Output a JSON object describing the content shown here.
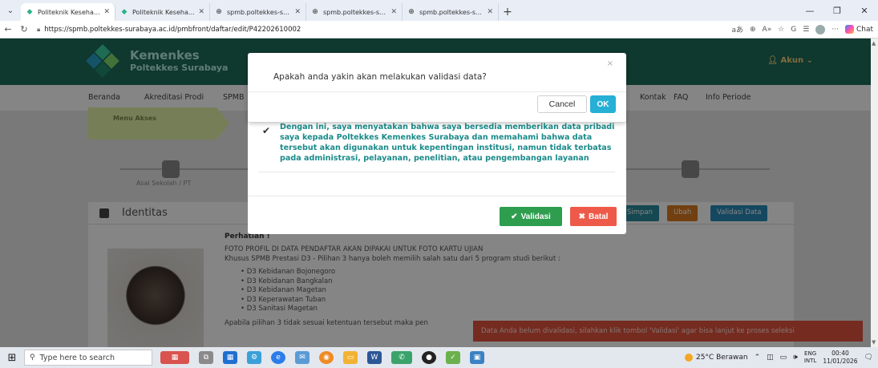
{
  "browser": {
    "tabs": [
      {
        "title": "Politeknik Kesehatan Kemenkes Su",
        "active": true
      },
      {
        "title": "Politeknik Kesehatan Kemenkes Su",
        "active": false
      },
      {
        "title": "spmb.poltekkes-surabaya.ac.id/pm",
        "active": false
      },
      {
        "title": "spmb.poltekkes-surabaya.ac.id/pm",
        "active": false
      },
      {
        "title": "spmb.poltekkes-surabaya.ac.id/pm",
        "active": false
      }
    ],
    "url": "https://spmb.poltekkes-surabaya.ac.id/pmbfront/daftar/edit/P42202610002",
    "copilot_label": "Chat"
  },
  "site": {
    "brand_line1": "Kemenkes",
    "brand_line2": "Poltekkes Surabaya",
    "account_label": "Akun",
    "nav_items": [
      "Beranda",
      "Akreditasi Prodi",
      "SPMB",
      "Kontak",
      "FAQ",
      "Info Periode"
    ],
    "menu_label": "Menu Akses",
    "step_label": "Asal Sekolah / PT",
    "section_title": "Identitas",
    "section_buttons": [
      "Simpan",
      "Ubah",
      "Validasi Data"
    ],
    "perhatian_title": "Perhatian !",
    "perhatian_line1": "FOTO PROFIL DI DATA PENDAFTAR AKAN DIPAKAI UNTUK FOTO KARTU UJIAN",
    "perhatian_line2": "Khusus SPMB Prestasi D3 - Pilihan 3 hanya boleh memilih salah satu dari 5 program studi berikut :",
    "program_list": [
      "D3 Kebidanan Bojonegoro",
      "D3 Kebidanan Bangkalan",
      "D3 Kebidanan Magetan",
      "D3 Keperawatan Tuban",
      "D3 Sanitasi Magetan"
    ],
    "perhatian_footer": "Apabila pilihan 3 tidak sesuai ketentuan tersebut maka pen",
    "toast_text": "Data Anda belum divalidasi, silahkan klik tombol 'Validasi' agar bisa lanjut ke proses seleksi"
  },
  "consent_modal": {
    "text": "Dengan ini, saya menyatakan bahwa saya bersedia memberikan data pribadi saya kepada Poltekkes Kemenkes Surabaya dan memahami bahwa data tersebut akan digunakan untuk kepentingan institusi, namun tidak terbatas pada administrasi, pelayanan, penelitian, atau pengembangan layanan",
    "validasi_label": "Validasi",
    "batal_label": "Batal"
  },
  "confirm_dialog": {
    "message": "Apakah anda yakin akan melakukan validasi data?",
    "close_glyph": "×",
    "cancel_label": "Cancel",
    "ok_label": "OK"
  },
  "taskbar": {
    "search_placeholder": "Type here to search",
    "weather": "25°C Berawan",
    "lang_line1": "ENG",
    "lang_line2": "INTL",
    "time": "00:40",
    "date": "11/01/2026"
  },
  "colors": {
    "header_green": "#1d6b58",
    "validasi_green": "#2e9e4e",
    "batal_red": "#ee5a4a",
    "ok_blue": "#26b0d6",
    "consent_teal": "#1a8a8a"
  }
}
